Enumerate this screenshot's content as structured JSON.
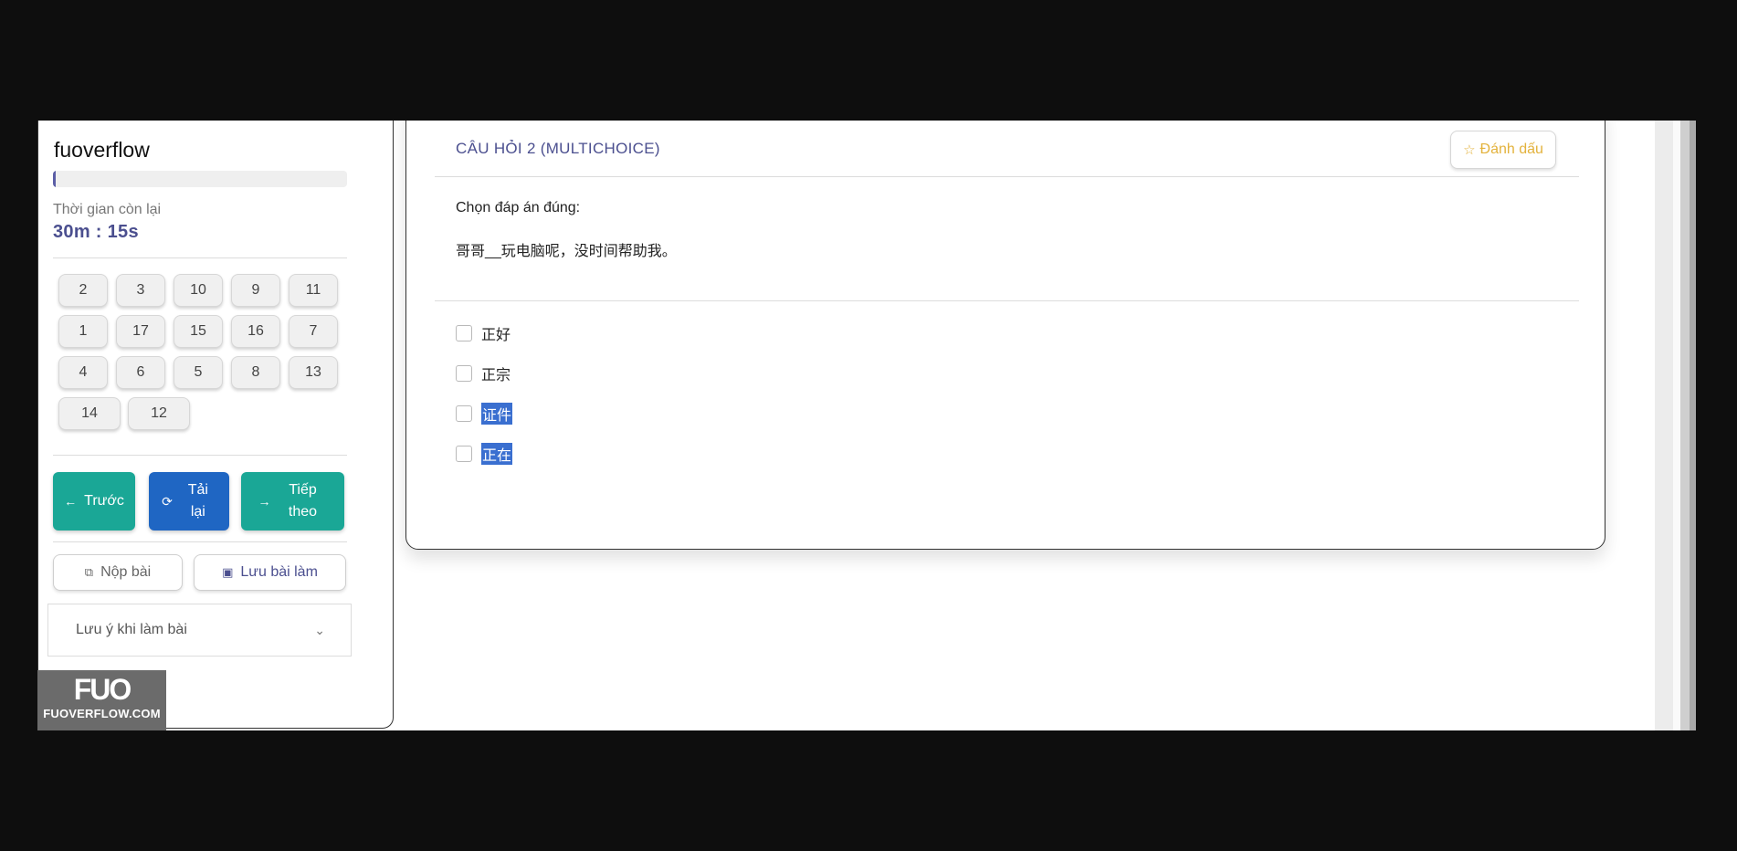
{
  "brand": "fuoverflow",
  "progress": {
    "fraction": 0.01
  },
  "timer": {
    "label": "Thời gian còn lại",
    "value": "30m : 15s"
  },
  "question_nav": {
    "rows": [
      [
        "2",
        "3",
        "10",
        "9",
        "11"
      ],
      [
        "1",
        "17",
        "15",
        "16",
        "7"
      ],
      [
        "4",
        "6",
        "5",
        "8",
        "13"
      ],
      [
        "14",
        "12"
      ]
    ]
  },
  "nav": {
    "prev": "Trước",
    "reload": "Tải lại",
    "next": "Tiếp theo"
  },
  "actions": {
    "submit": "Nộp bài",
    "save": "Lưu bài làm"
  },
  "notes": {
    "label": "Lưu ý khi làm bài"
  },
  "watermark": {
    "logo": "FUO",
    "url": "FUOVERFLOW.COM"
  },
  "question": {
    "title": "CÂU HỎI 2 (MULTICHOICE)",
    "flag_label": "Đánh dấu",
    "prompt": "Chọn đáp án đúng:",
    "text": "哥哥__玩电脑呢，没时间帮助我。",
    "options": [
      {
        "label": "正好",
        "highlighted": false
      },
      {
        "label": "正宗",
        "highlighted": false
      },
      {
        "label": "证件",
        "highlighted": true
      },
      {
        "label": "正在",
        "highlighted": true
      }
    ]
  },
  "colors": {
    "accent": "#4b4f8f",
    "teal": "#1aa796",
    "blue": "#1f66c3",
    "flag": "#e3b23c",
    "selection": "#3a6fd0"
  }
}
